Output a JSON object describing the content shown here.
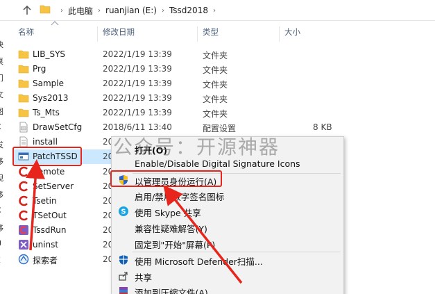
{
  "address": {
    "crumbs": [
      "此电脑",
      "ruanjian (E:)",
      "Tssd2018"
    ]
  },
  "columns": {
    "name": "名称",
    "modified": "修改日期",
    "type": "类型",
    "size": "大小"
  },
  "left_glyphs": [
    "快",
    "桌",
    "门",
    "文",
    "图",
    "C",
    "发",
    "移",
    "视",
    "移",
    "C",
    "移",
    "U",
    "E"
  ],
  "files": [
    {
      "icon": "folder-icon",
      "name": "LIB_SYS",
      "modified": "2022/1/19 13:39",
      "type": "文件夹",
      "size": ""
    },
    {
      "icon": "folder-icon",
      "name": "Prg",
      "modified": "2022/1/19 13:39",
      "type": "文件夹",
      "size": ""
    },
    {
      "icon": "folder-icon",
      "name": "Sample",
      "modified": "2022/1/19 13:39",
      "type": "文件夹",
      "size": ""
    },
    {
      "icon": "folder-icon",
      "name": "Sys2013",
      "modified": "2022/1/19 13:39",
      "type": "文件夹",
      "size": ""
    },
    {
      "icon": "folder-icon",
      "name": "Ts_Mts",
      "modified": "2022/1/19 13:39",
      "type": "文件夹",
      "size": ""
    },
    {
      "icon": "config-file-icon",
      "name": "DrawSetCfg",
      "modified": "2018/6/11 13:40",
      "type": "配置设置",
      "size": "8 KB"
    },
    {
      "icon": "text-file-icon",
      "name": "install",
      "modified": "20",
      "type": "",
      "size": ""
    },
    {
      "icon": "patch-app-icon",
      "name": "PatchTSSD",
      "modified": "20",
      "type": "",
      "size": ""
    },
    {
      "icon": "tssd-c-icon",
      "name": "Remote",
      "modified": "20",
      "type": "",
      "size": ""
    },
    {
      "icon": "tssd-c-icon",
      "name": "SetServer",
      "modified": "20",
      "type": "",
      "size": ""
    },
    {
      "icon": "tssd-c-icon",
      "name": "Tsetin",
      "modified": "20",
      "type": "",
      "size": ""
    },
    {
      "icon": "tssd-c-icon",
      "name": "TSetOut",
      "modified": "20",
      "type": "",
      "size": ""
    },
    {
      "icon": "tssd-run-icon",
      "name": "TssdRun",
      "modified": "20",
      "type": "",
      "size": ""
    },
    {
      "icon": "uninstall-icon",
      "name": "uninst",
      "modified": "20",
      "type": "",
      "size": ""
    },
    {
      "icon": "explorer-app-icon",
      "name": "探索者",
      "modified": "20",
      "type": "",
      "size": ""
    }
  ],
  "context_menu": {
    "items": [
      {
        "label": "打开(O)",
        "icon": "",
        "bold": true
      },
      {
        "label": "Enable/Disable Digital Signature Icons",
        "icon": ""
      },
      {
        "label": "以管理员身份运行(A)",
        "icon": "uac-shield-icon"
      },
      {
        "label": "启用/禁用数字签名图标",
        "icon": ""
      },
      {
        "label": "使用 Skype 共享",
        "icon": "skype-icon"
      },
      {
        "label": "兼容性疑难解答(Y)",
        "icon": ""
      },
      {
        "label": "固定到\"开始\"屏幕(P)",
        "icon": ""
      },
      {
        "label": "使用 Microsoft Defender扫描...",
        "icon": "defender-icon"
      },
      {
        "label": "共享",
        "icon": "share-icon"
      },
      {
        "label": "添加到压缩文件(A)...",
        "icon": "winrar-icon"
      }
    ]
  },
  "watermark": "公众号：开源神器",
  "colors": {
    "selection": "#cce8ff",
    "annotation_red": "#e8251c",
    "folder": "#f6c343",
    "menu_bg": "#f2f2f2"
  }
}
